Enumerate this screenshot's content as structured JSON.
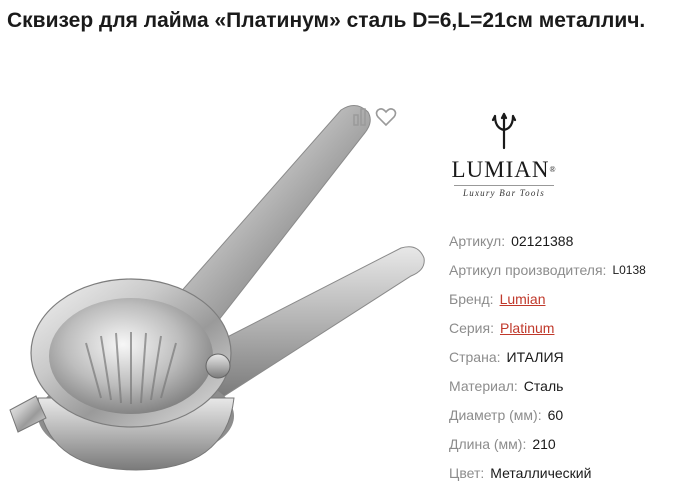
{
  "title": "Сквизер для лайма «Платинум» сталь D=6,L=21см металлич.",
  "product_image_alt": "squeezer",
  "actions": {
    "compare_icon": "compare-icon",
    "favorite_icon": "heart-icon"
  },
  "brand": {
    "logo_text": "LUMIAN",
    "logo_mark": "®",
    "tagline": "Luxury Bar Tools"
  },
  "specs": [
    {
      "label": "Артикул:",
      "value": "02121388",
      "link": false
    },
    {
      "label": "Артикул производителя:",
      "value": "L0138",
      "link": false
    },
    {
      "label": "Бренд:",
      "value": "Lumian",
      "link": true
    },
    {
      "label": "Серия:",
      "value": "Platinum",
      "link": true
    },
    {
      "label": "Страна:",
      "value": "ИТАЛИЯ",
      "link": false
    },
    {
      "label": "Материал:",
      "value": "Сталь",
      "link": false
    },
    {
      "label": "Диаметр (мм):",
      "value": "60",
      "link": false
    },
    {
      "label": "Длина (мм):",
      "value": "210",
      "link": false
    },
    {
      "label": "Цвет:",
      "value": "Металлический",
      "link": false
    }
  ],
  "colors": {
    "link": "#c0392b",
    "label": "#8c8c8c",
    "text": "#1a1a1a"
  }
}
